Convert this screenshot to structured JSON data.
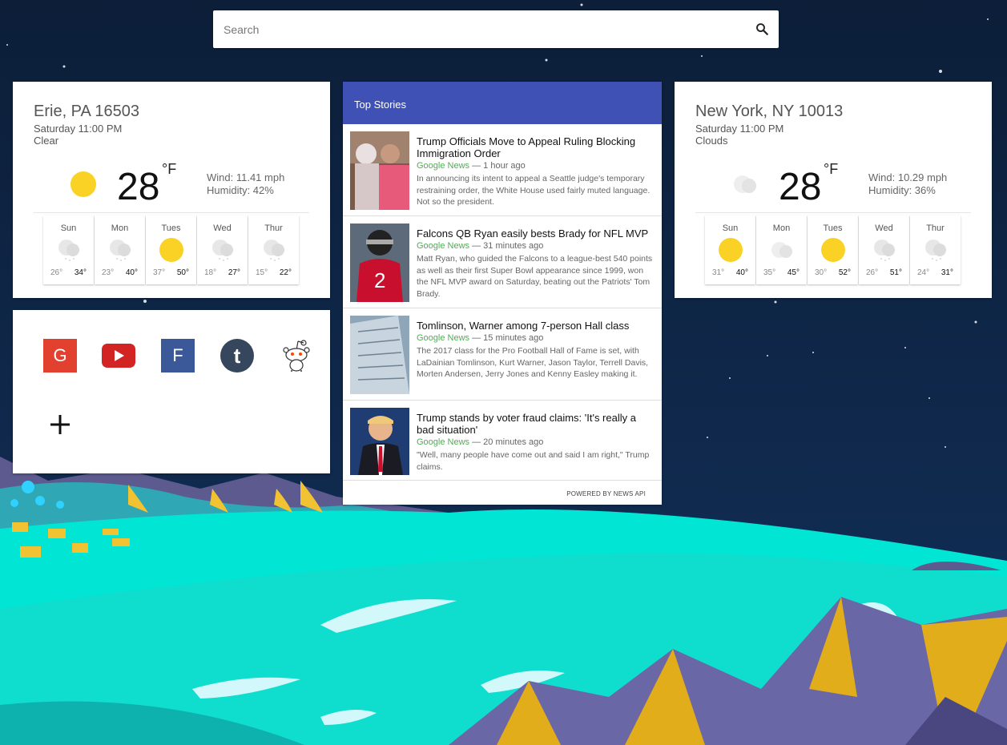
{
  "search": {
    "placeholder": "Search"
  },
  "weather_left": {
    "city": "Erie, PA 16503",
    "time": "Saturday 11:00 PM",
    "condition": "Clear",
    "icon": "sun-icon",
    "temp": "28",
    "unit": "°F",
    "wind": "Wind: 11.41 mph",
    "humidity": "Humidity: 42%",
    "forecast": [
      {
        "day": "Sun",
        "icon": "cloud-rain-icon",
        "lo": "26°",
        "hi": "34°"
      },
      {
        "day": "Mon",
        "icon": "cloud-rain-icon",
        "lo": "23°",
        "hi": "40°"
      },
      {
        "day": "Tues",
        "icon": "sun-icon",
        "lo": "37°",
        "hi": "50°"
      },
      {
        "day": "Wed",
        "icon": "cloud-rain-icon",
        "lo": "18°",
        "hi": "27°"
      },
      {
        "day": "Thur",
        "icon": "cloud-rain-icon",
        "lo": "15°",
        "hi": "22°"
      }
    ]
  },
  "weather_right": {
    "city": "New York, NY 10013",
    "time": "Saturday 11:00 PM",
    "condition": "Clouds",
    "icon": "cloud-icon",
    "temp": "28",
    "unit": "°F",
    "wind": "Wind: 10.29 mph",
    "humidity": "Humidity: 36%",
    "forecast": [
      {
        "day": "Sun",
        "icon": "sun-icon",
        "lo": "31°",
        "hi": "40°"
      },
      {
        "day": "Mon",
        "icon": "cloud-icon",
        "lo": "35°",
        "hi": "45°"
      },
      {
        "day": "Tues",
        "icon": "sun-icon",
        "lo": "30°",
        "hi": "52°"
      },
      {
        "day": "Wed",
        "icon": "cloud-rain-icon",
        "lo": "26°",
        "hi": "51°"
      },
      {
        "day": "Thur",
        "icon": "cloud-rain-icon",
        "lo": "24°",
        "hi": "31°"
      }
    ]
  },
  "apps": [
    {
      "name": "google",
      "label": "G",
      "color": "#e3412f"
    },
    {
      "name": "youtube",
      "label": "",
      "color": "#d32424"
    },
    {
      "name": "facebook",
      "label": "F",
      "color": "#3b5998"
    },
    {
      "name": "tumblr",
      "label": "t",
      "color": "#36465d"
    },
    {
      "name": "reddit",
      "label": "",
      "color": "#ffffff"
    }
  ],
  "news": {
    "header": "Top Stories",
    "powered": "POWERED BY NEWS API",
    "stories": [
      {
        "title": "Trump Officials Move to Appeal Ruling Blocking Immigration Order",
        "source": "Google News",
        "ago": "1 hour ago",
        "desc": "In announcing its intent to appeal a Seattle judge's temporary restraining order, the White House used fairly muted language. Not so the president."
      },
      {
        "title": "Falcons QB Ryan easily bests Brady for NFL MVP",
        "source": "Google News",
        "ago": "31 minutes ago",
        "desc": "Matt Ryan, who guided the Falcons to a league-best 540 points as well as their first Super Bowl appearance since 1999, won the NFL MVP award on Saturday, beating out the Patriots' Tom Brady."
      },
      {
        "title": "Tomlinson, Warner among 7-person Hall class",
        "source": "Google News",
        "ago": "15 minutes ago",
        "desc": "The 2017 class for the Pro Football Hall of Fame is set, with LaDainian Tomlinson, Kurt Warner, Jason Taylor, Terrell Davis, Morten Andersen, Jerry Jones and Kenny Easley making it."
      },
      {
        "title": "Trump stands by voter fraud claims: 'It's really a bad situation'",
        "source": "Google News",
        "ago": "20 minutes ago",
        "desc": "\"Well, many people have come out and said I am right,\" Trump claims."
      }
    ]
  }
}
